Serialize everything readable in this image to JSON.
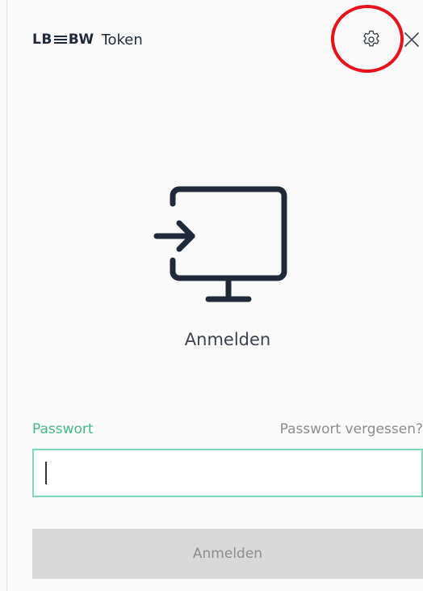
{
  "header": {
    "brand_left": "LB",
    "brand_right": "BW",
    "app_title": "Token",
    "settings_icon": "gear-icon",
    "close_icon": "close-icon",
    "highlight_color": "#e8121b"
  },
  "main": {
    "hero_icon": "login-monitor-icon",
    "title": "Anmelden"
  },
  "form": {
    "password_label": "Passwort",
    "forgot_link": "Passwort vergessen?",
    "password_value": "",
    "submit_label": "Anmelden",
    "submit_enabled": false
  },
  "colors": {
    "accent_green": "#44b98a",
    "input_border": "#7fd7b5",
    "icon_navy": "#1e2a3a",
    "disabled_button": "#d9d9d9"
  }
}
